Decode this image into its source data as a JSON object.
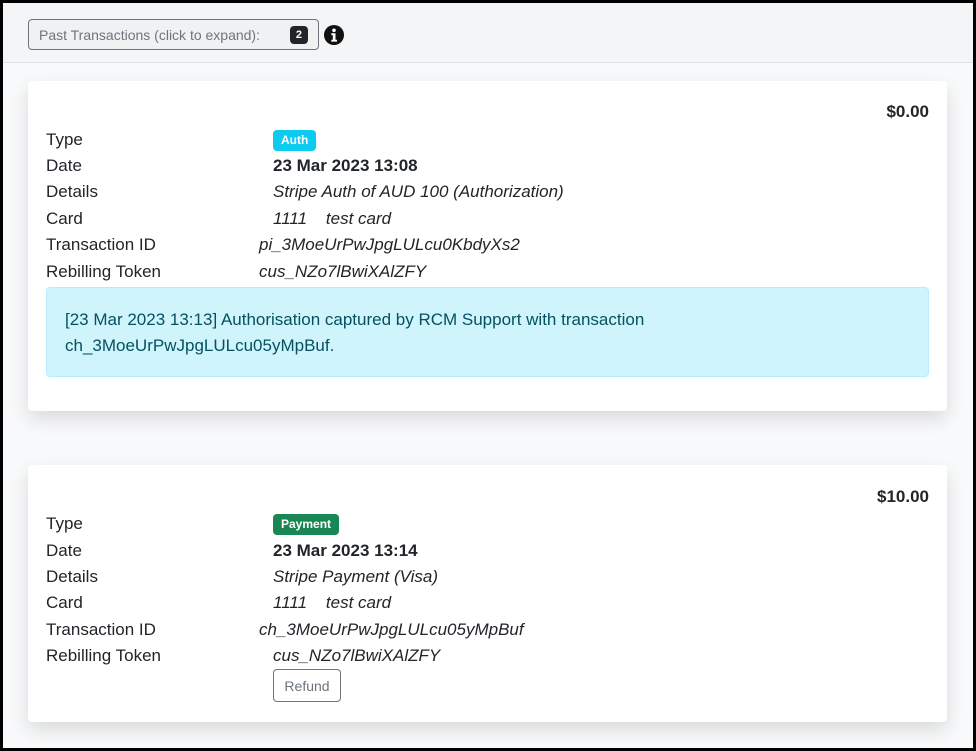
{
  "header": {
    "past_transactions_label": "Past Transactions (click to expand):",
    "past_transactions_count": "2",
    "info_icon": "info-circle-icon"
  },
  "labels": {
    "type": "Type",
    "date": "Date",
    "details": "Details",
    "card": "Card",
    "transaction_id": "Transaction ID",
    "rebilling_token": "Rebilling Token"
  },
  "transactions": [
    {
      "amount": "$0.00",
      "type_badge": "Auth",
      "badge_color": "#0dcaf0",
      "date": "23 Mar 2023 13:08",
      "details": "Stripe Auth of AUD 100 (Authorization)",
      "card": "1111    test card",
      "transaction_id": "pi_3MoeUrPwJpgLULcu0KbdyXs2",
      "rebilling_token": "cus_NZo7lBwiXAlZFY",
      "note": "[23 Mar 2023 13:13] Authorisation captured by RCM Support with transaction ch_3MoeUrPwJpgLULcu05yMpBuf."
    },
    {
      "amount": "$10.00",
      "type_badge": "Payment",
      "badge_color": "#198754",
      "date": "23 Mar 2023 13:14",
      "details": "Stripe Payment (Visa)",
      "card": "1111    test card",
      "transaction_id": "ch_3MoeUrPwJpgLULcu05yMpBuf",
      "rebilling_token": "cus_NZo7lBwiXAlZFY",
      "refund_label": "Refund"
    }
  ]
}
